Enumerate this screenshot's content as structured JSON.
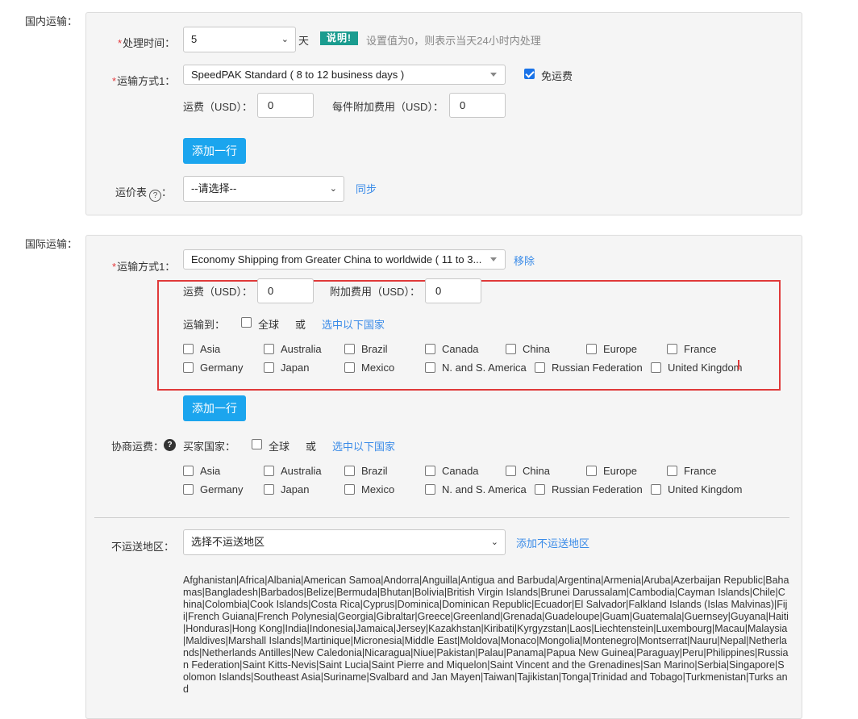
{
  "domestic": {
    "section_label": "国内运输：",
    "handling_time_label": "处理时间：",
    "handling_time_value": "5",
    "days_unit": "天",
    "note_badge": "说明!",
    "note_text": "设置值为0，则表示当天24小时内处理",
    "shipping_method_label": "运输方式1：",
    "shipping_method_value": "SpeedPAK Standard ( 8 to 12 business days )",
    "free_shipping_label": "免运费",
    "free_shipping_checked": true,
    "shipping_fee_label": "运费（USD）：",
    "shipping_fee_value": "0",
    "additional_fee_label": "每件附加费用（USD）：",
    "additional_fee_value": "0",
    "add_row_button": "添加一行",
    "rate_table_label": "运价表",
    "rate_table_value": "--请选择--",
    "sync_link": "同步"
  },
  "international": {
    "section_label": "国际运输：",
    "shipping_method_label": "运输方式1：",
    "shipping_method_value": "Economy Shipping from Greater China to worldwide ( 11 to 3...",
    "remove_link": "移除",
    "shipping_fee_label": "运费（USD）：",
    "shipping_fee_value": "0",
    "additional_fee_label": "附加费用（USD）：",
    "additional_fee_value": "0",
    "ship_to_label": "运输到：",
    "global_label": "全球",
    "or_label": "或",
    "select_countries_link": "选中以下国家",
    "ship_to_regions": [
      "Asia",
      "Australia",
      "Brazil",
      "Canada",
      "China",
      "Europe",
      "France",
      "Germany",
      "Japan",
      "Mexico",
      "N. and S. America",
      "Russian Federation",
      "United Kingdom"
    ],
    "add_row_button": "添加一行",
    "negotiated_label": "协商运费：",
    "buyer_country_label": "买家国家：",
    "negotiated_global_label": "全球",
    "negotiated_or_label": "或",
    "negotiated_select_link": "选中以下国家",
    "negotiated_regions": [
      "Asia",
      "Australia",
      "Brazil",
      "Canada",
      "China",
      "Europe",
      "France",
      "Germany",
      "Japan",
      "Mexico",
      "N. and S. America",
      "Russian Federation",
      "United Kingdom"
    ],
    "excluded_label": "不运送地区：",
    "excluded_select_value": "选择不运送地区",
    "add_excluded_link": "添加不运送地区",
    "excluded_countries_text": "Afghanistan|Africa|Albania|American Samoa|Andorra|Anguilla|Antigua and Barbuda|Argentina|Armenia|Aruba|Azerbaijan Republic|Bahamas|Bangladesh|Barbados|Belize|Bermuda|Bhutan|Bolivia|British Virgin Islands|Brunei Darussalam|Cambodia|Cayman Islands|Chile|China|Colombia|Cook Islands|Costa Rica|Cyprus|Dominica|Dominican Republic|Ecuador|El Salvador|Falkland Islands (Islas Malvinas)|Fiji|French Guiana|French Polynesia|Georgia|Gibraltar|Greece|Greenland|Grenada|Guadeloupe|Guam|Guatemala|Guernsey|Guyana|Haiti|Honduras|Hong Kong|India|Indonesia|Jamaica|Jersey|Kazakhstan|Kiribati|Kyrgyzstan|Laos|Liechtenstein|Luxembourg|Macau|Malaysia|Maldives|Marshall Islands|Martinique|Micronesia|Middle East|Moldova|Monaco|Mongolia|Montenegro|Montserrat|Nauru|Nepal|Netherlands|Netherlands Antilles|New Caledonia|Nicaragua|Niue|Pakistan|Palau|Panama|Papua New Guinea|Paraguay|Peru|Philippines|Russian Federation|Saint Kitts-Nevis|Saint Lucia|Saint Pierre and Miquelon|Saint Vincent and the Grenadines|San Marino|Serbia|Singapore|Solomon Islands|Southeast Asia|Suriname|Svalbard and Jan Mayen|Taiwan|Tajikistan|Tonga|Trinidad and Tobago|Turkmenistan|Turks and"
  },
  "colors": {
    "button": "#1ba5ee",
    "link": "#3a8be8",
    "badge": "#1a9c8f",
    "highlight_box": "#e03a3a",
    "required": "#e4393c"
  }
}
